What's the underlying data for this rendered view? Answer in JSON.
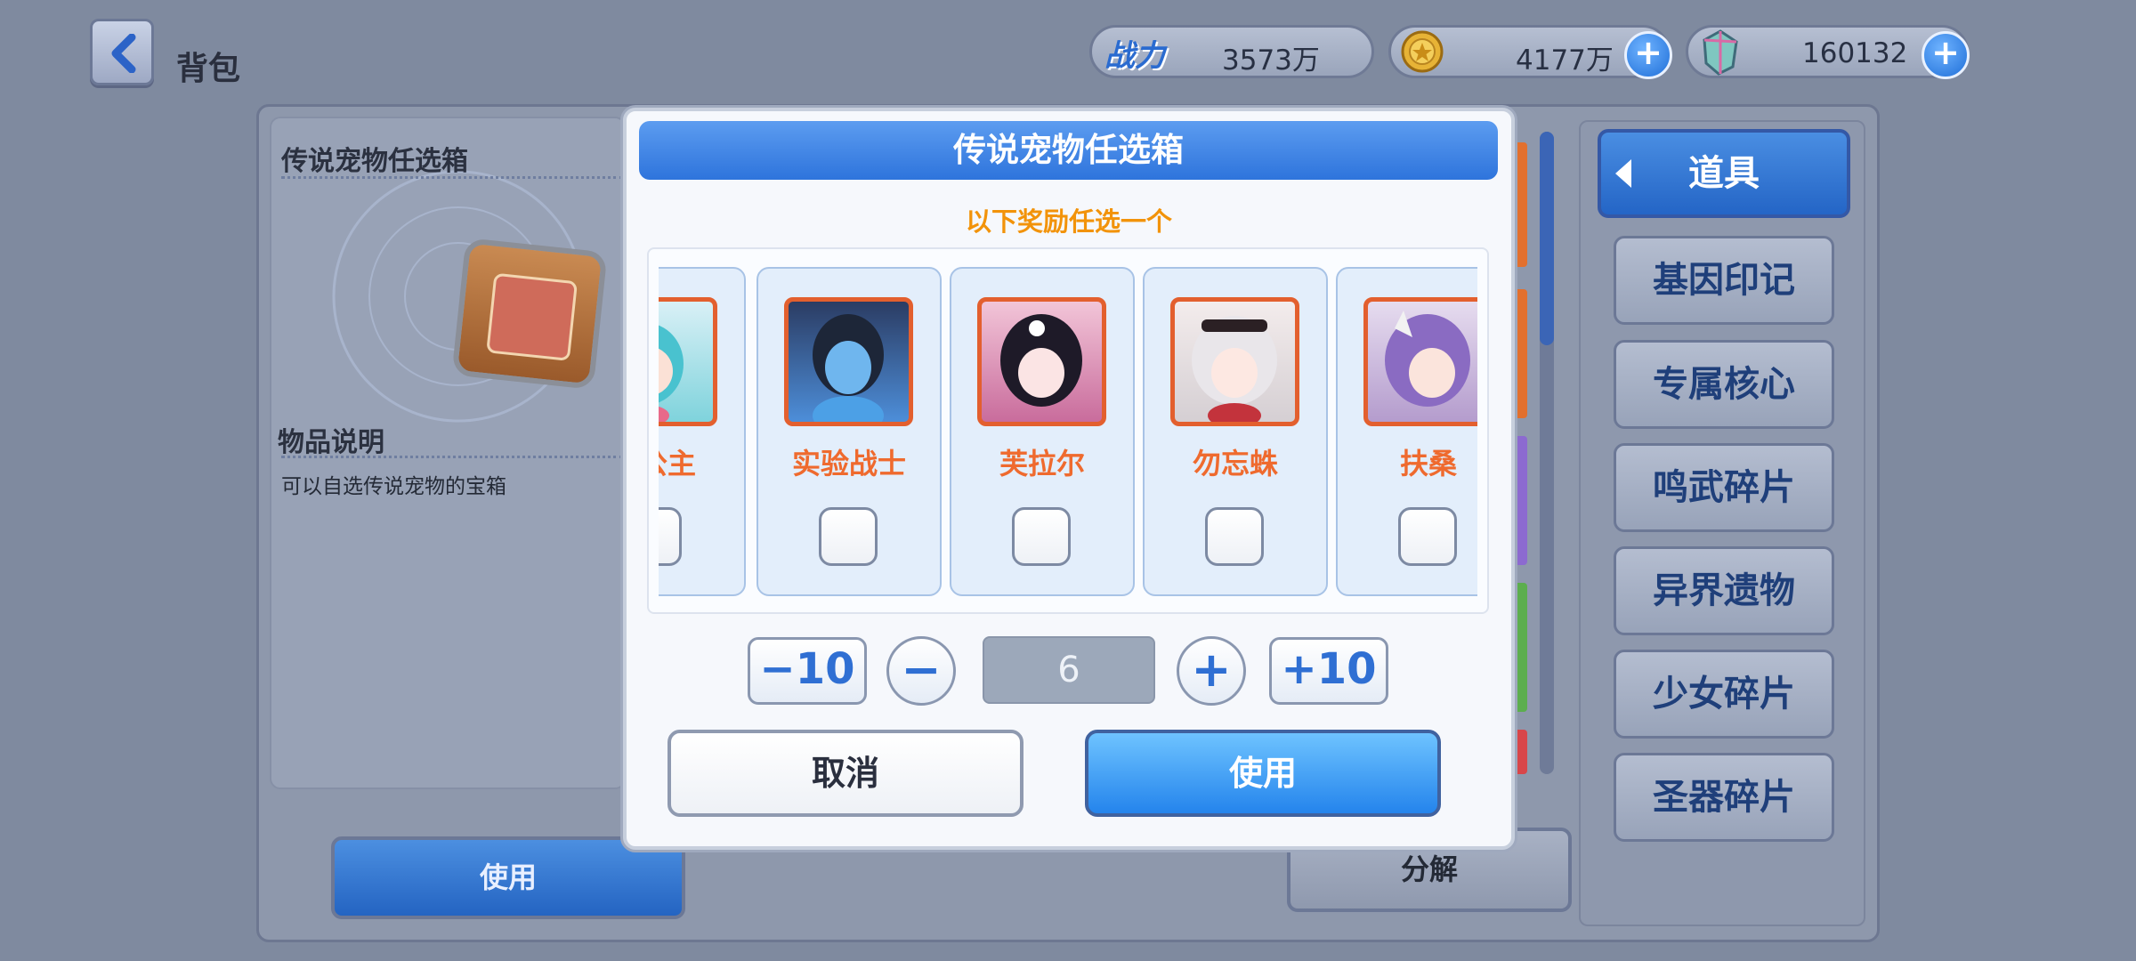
{
  "topbar": {
    "title": "背包",
    "power_label": "战力",
    "power_value": "3573万",
    "coin_value": "4177万",
    "gem_value": "160132"
  },
  "left": {
    "item_title": "传说宠物任选箱",
    "desc_heading": "物品说明",
    "desc_text": "可以自选传说宠物的宝箱",
    "use_label": "使用"
  },
  "decompose_label": "分解",
  "categories": {
    "active": "道具",
    "items": [
      "基因印记",
      "专属核心",
      "鸣武碎片",
      "异界遗物",
      "少女碎片",
      "圣器碎片"
    ]
  },
  "dialog": {
    "title": "传说宠物任选箱",
    "subtitle": "以下奖励任选一个",
    "pets": [
      {
        "name": "汐公主",
        "checked": false
      },
      {
        "name": "实验战士",
        "checked": false
      },
      {
        "name": "芙拉尔",
        "checked": false
      },
      {
        "name": "勿忘蛛",
        "checked": false
      },
      {
        "name": "扶桑",
        "checked": false
      }
    ],
    "qty": {
      "minus10": "−10",
      "minus": "−",
      "value": "6",
      "plus": "+",
      "plus10": "+10"
    },
    "cancel_label": "取消",
    "confirm_label": "使用"
  },
  "colors": {
    "accent_blue": "#2e74dc",
    "subtitle_orange": "#f2930a",
    "pet_name_orange": "#ef6a2e"
  }
}
